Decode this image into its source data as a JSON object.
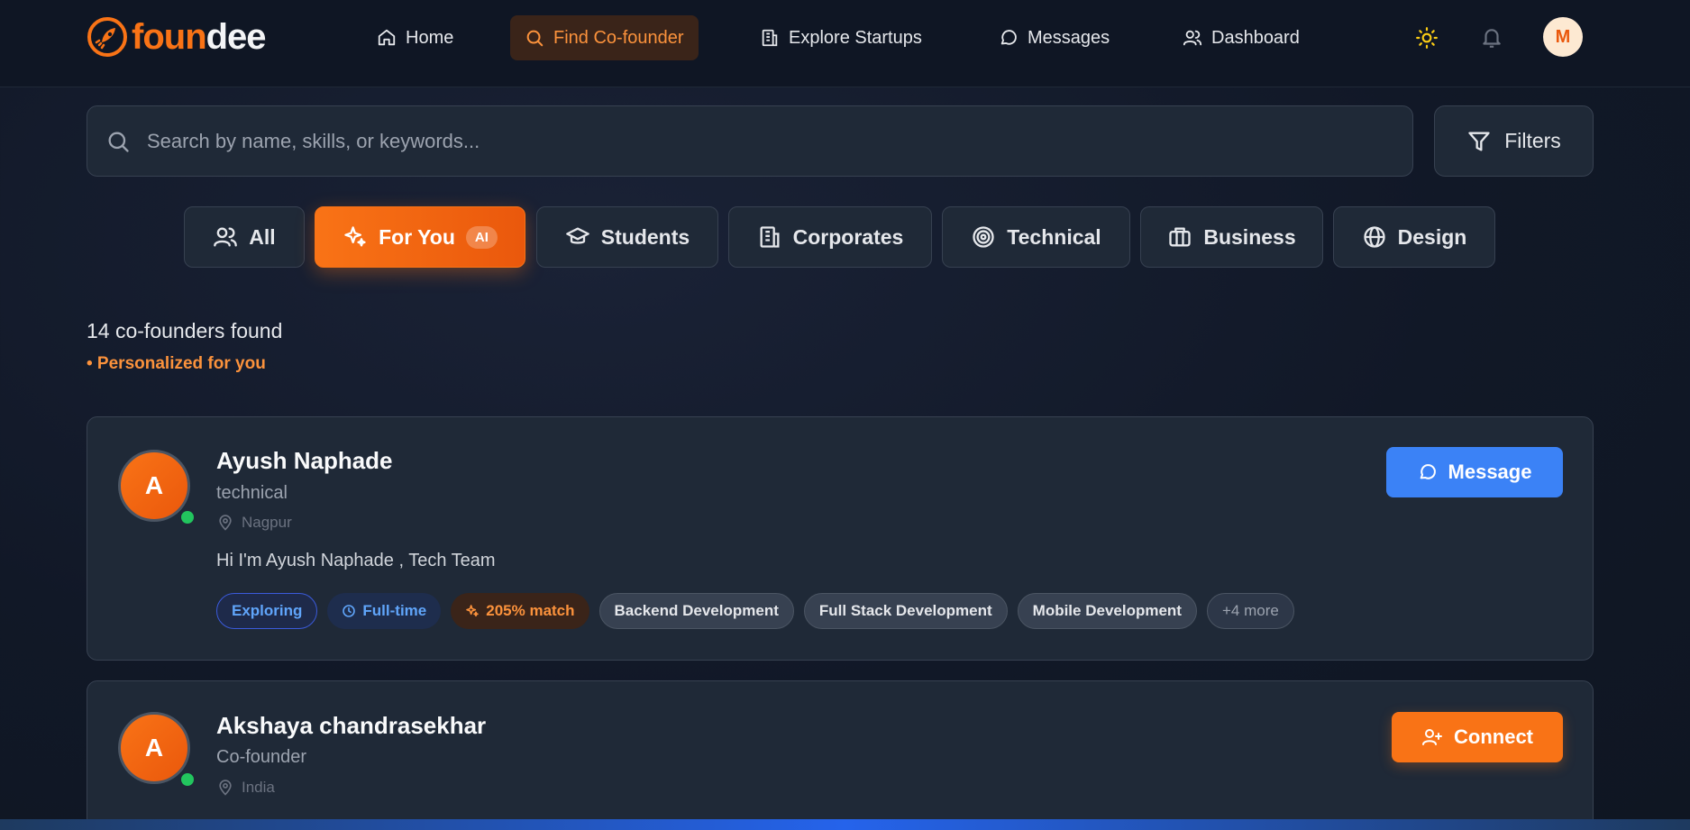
{
  "brand": {
    "part1": "foun",
    "part2": "dee",
    "accent": "#f97316"
  },
  "nav": {
    "items": [
      {
        "label": "Home",
        "icon": "home-icon"
      },
      {
        "label": "Find Co-founder",
        "icon": "search-icon",
        "active": true
      },
      {
        "label": "Explore Startups",
        "icon": "building-icon"
      },
      {
        "label": "Messages",
        "icon": "message-icon"
      },
      {
        "label": "Dashboard",
        "icon": "users-icon"
      }
    ],
    "avatar_initial": "M"
  },
  "search": {
    "placeholder": "Search by name, skills, or keywords...",
    "value": ""
  },
  "filters_label": "Filters",
  "tabs": [
    {
      "label": "All",
      "icon": "users-icon"
    },
    {
      "label": "For You",
      "icon": "sparkles-icon",
      "badge": "AI",
      "active": true
    },
    {
      "label": "Students",
      "icon": "graduation-cap-icon"
    },
    {
      "label": "Corporates",
      "icon": "building-icon"
    },
    {
      "label": "Technical",
      "icon": "target-icon"
    },
    {
      "label": "Business",
      "icon": "briefcase-icon"
    },
    {
      "label": "Design",
      "icon": "globe-icon"
    }
  ],
  "results": {
    "count_text": "14 co-founders found",
    "personalized_text": "• Personalized for you"
  },
  "cards": [
    {
      "initial": "A",
      "name": "Ayush Naphade",
      "role": "technical",
      "location": "Nagpur",
      "bio": "Hi I'm Ayush Naphade , Tech Team",
      "action": "Message",
      "tags": {
        "status": "Exploring",
        "time": "Full-time",
        "match": "205% match",
        "skills": [
          "Backend Development",
          "Full Stack Development",
          "Mobile Development"
        ],
        "more": "+4 more"
      }
    },
    {
      "initial": "A",
      "name": "Akshaya chandrasekhar",
      "role": "Co-founder",
      "location": "India",
      "action": "Connect"
    }
  ]
}
